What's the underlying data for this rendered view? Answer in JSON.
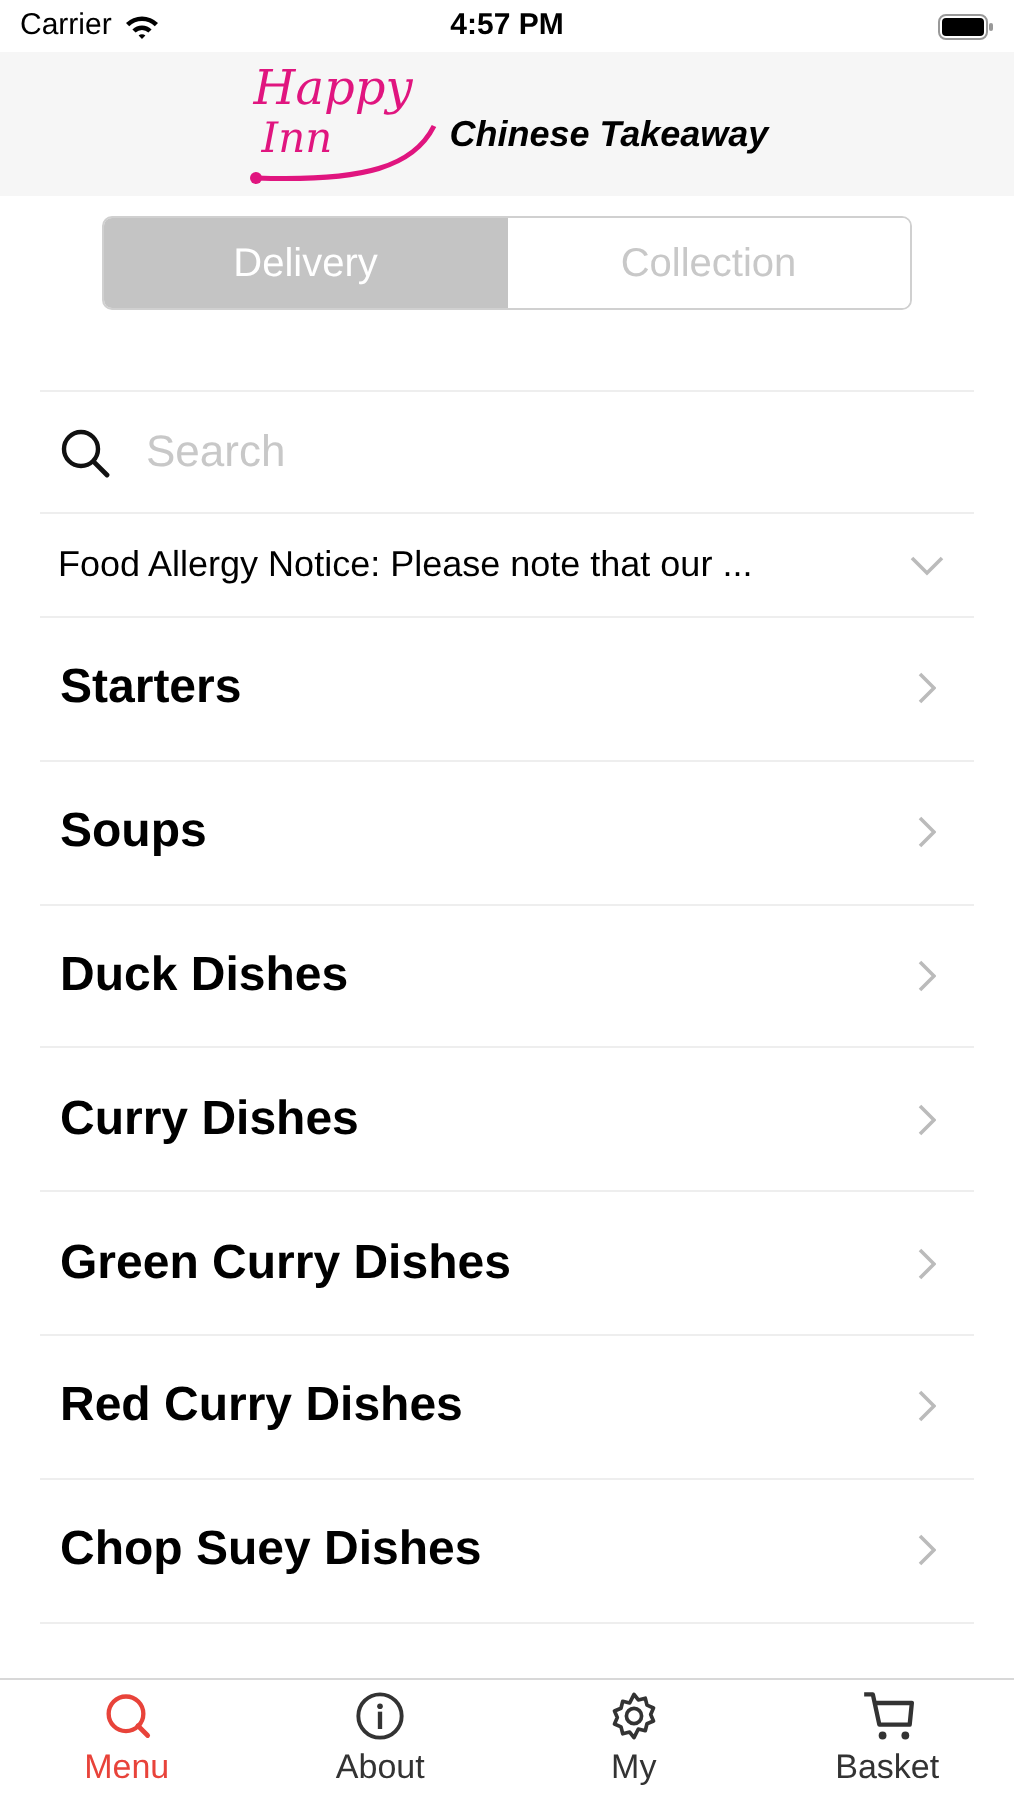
{
  "status_bar": {
    "carrier": "Carrier",
    "time": "4:57 PM"
  },
  "header": {
    "logo_line_1": "Happy",
    "logo_line_2": "Inn",
    "subtitle": "Chinese Takeaway"
  },
  "segments": [
    {
      "label": "Delivery",
      "selected": true
    },
    {
      "label": "Collection",
      "selected": false
    }
  ],
  "search": {
    "placeholder": "Search"
  },
  "notice": {
    "text": "Food Allergy Notice: Please note that our ...",
    "expanded": false
  },
  "categories": [
    {
      "label": "Starters"
    },
    {
      "label": "Soups"
    },
    {
      "label": "Duck Dishes"
    },
    {
      "label": "Curry Dishes"
    },
    {
      "label": "Green Curry Dishes"
    },
    {
      "label": "Red Curry Dishes"
    },
    {
      "label": "Chop Suey Dishes"
    }
  ],
  "tab_bar": [
    {
      "label": "Menu",
      "kind": "search",
      "selected": true
    },
    {
      "label": "About",
      "kind": "info",
      "selected": false
    },
    {
      "label": "My",
      "kind": "gear",
      "selected": false
    },
    {
      "label": "Basket",
      "kind": "cart",
      "selected": false
    }
  ]
}
